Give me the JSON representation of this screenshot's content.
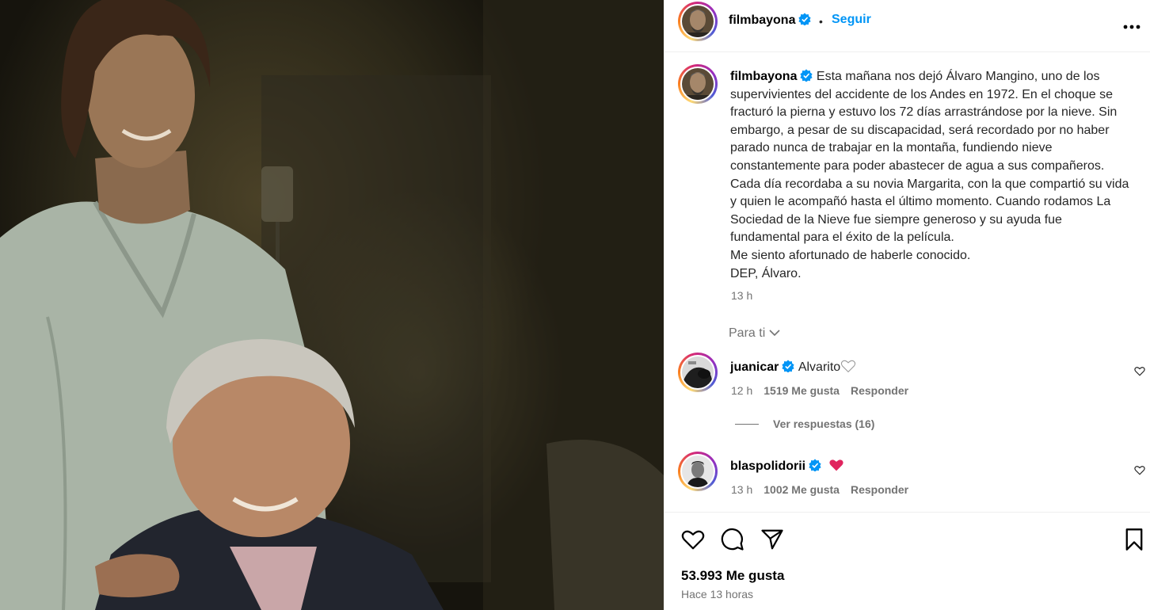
{
  "post": {
    "author": "filmbayona",
    "follow_label": "Seguir",
    "separator": "•",
    "caption": "Esta mañana nos dejó Álvaro Mangino, uno de los supervivientes del accidente de los Andes en 1972. En el choque se fracturó la pierna y estuvo los 72 días arrastrándose por la nieve. Sin embargo, a pesar de su discapacidad, será recordado por no haber parado nunca de trabajar en la montaña, fundiendo nieve constantemente para poder abastecer de agua a sus compañeros. Cada día recordaba a su novia Margarita, con la que compartió su vida y quien le acompañó hasta el último momento. Cuando rodamos La Sociedad de la Nieve fue siempre generoso y su ayuda fue fundamental para el éxito de la película.",
    "caption_line2": "Me siento afortunado de haberle conocido.",
    "caption_line3": "DEP, Álvaro.",
    "caption_time": "13 h",
    "filter_label": "Para ti",
    "likes": "53.993 Me gusta",
    "posted_ago": "Hace 13 horas"
  },
  "comments": [
    {
      "user": "juanicar",
      "text": "Alvarito",
      "time": "12 h",
      "likes": "1519 Me gusta",
      "reply_label": "Responder",
      "view_replies": "Ver respuestas (16)"
    },
    {
      "user": "blaspolidorii",
      "text": "",
      "time": "13 h",
      "likes": "1002 Me gusta",
      "reply_label": "Responder"
    }
  ],
  "icons": {
    "verified": "verified-badge-icon",
    "more": "more-options-icon",
    "like": "heart-icon",
    "comment": "comment-icon",
    "share": "share-icon",
    "save": "bookmark-icon",
    "chevron": "chevron-down-icon"
  },
  "colors": {
    "accent": "#0095f6",
    "secondary_text": "#737373",
    "heart_red": "#e0245e"
  }
}
